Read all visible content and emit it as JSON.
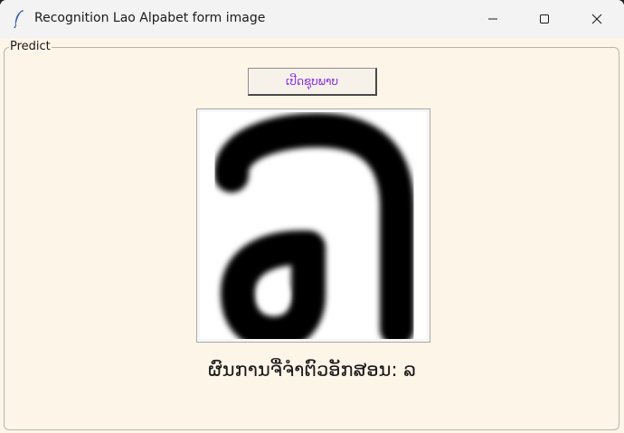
{
  "window": {
    "title": "Recognition Lao Alpabet form image",
    "app_icon": "feather-icon",
    "controls": [
      "minimize-icon",
      "maximize-icon",
      "close-icon"
    ]
  },
  "frame": {
    "label": "Predict"
  },
  "browse_button": {
    "label": "ເປີດຊຸບພາບ",
    "text_color": "#8a2be2"
  },
  "image": {
    "glyph": "ລ"
  },
  "result": {
    "text": "ຜົນການຈື່ຈຳຕົວອັກສອນ: ລ"
  },
  "colors": {
    "background": "#fdf5e8",
    "titlebar": "#f3f3f3"
  }
}
